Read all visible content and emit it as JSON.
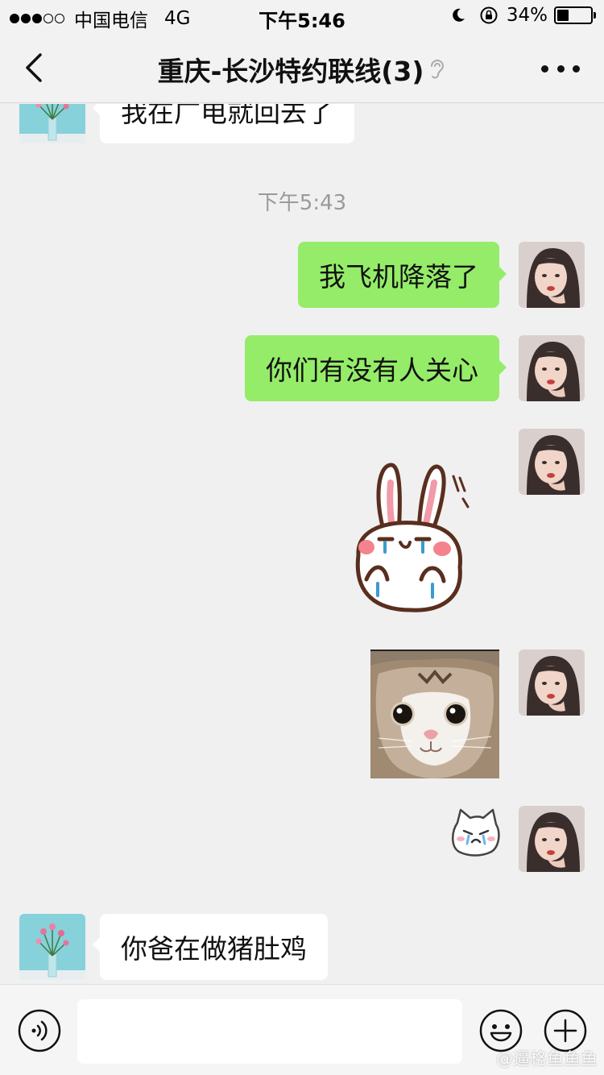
{
  "status": {
    "carrier": "中国电信",
    "network": "4G",
    "time": "下午5:46",
    "battery_pct": "34%",
    "battery_level": 0.34
  },
  "nav": {
    "title": "重庆-长沙特约联线(3)"
  },
  "messages": {
    "m0_text": "我在广电就回去了",
    "timestamp": "下午5:43",
    "m1_text": "我飞机降落了",
    "m2_text": "你们有没有人关心",
    "m6_text": "你爸在做猪肚鸡"
  },
  "input": {
    "placeholder": ""
  },
  "watermark": "@逼格鱼鱼鱼",
  "colors": {
    "bubble_green": "#95ec69",
    "bubble_white": "#ffffff",
    "background": "#f0f0f0"
  }
}
